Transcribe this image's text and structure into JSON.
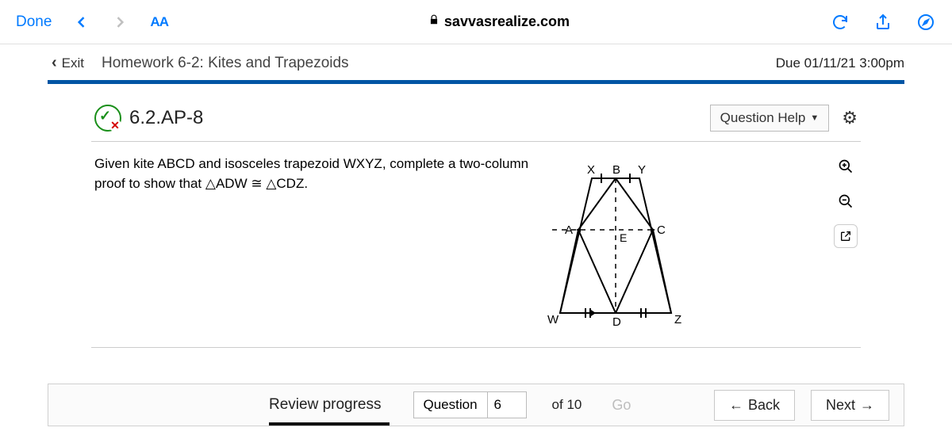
{
  "browser": {
    "done": "Done",
    "text_size": "AA",
    "url": "savvasrealize.com"
  },
  "assignment": {
    "exit": "Exit",
    "title": "Homework 6-2: Kites and Trapezoids",
    "due": "Due 01/11/21 3:00pm"
  },
  "question": {
    "id": "6.2.AP-8",
    "help_label": "Question Help",
    "prompt_line1": "Given kite ABCD and isosceles trapezoid WXYZ, complete a two-column",
    "prompt_line2": "proof to show that ",
    "tri_adw": "ADW",
    "congruent": " ≅ ",
    "tri_cdz": "CDZ."
  },
  "figure": {
    "labels": {
      "X": "X",
      "B": "B",
      "Y": "Y",
      "A": "A",
      "C": "C",
      "E": "E",
      "W": "W",
      "D": "D",
      "Z": "Z"
    }
  },
  "footer": {
    "review": "Review progress",
    "question_label": "Question",
    "current": "6",
    "of": "of 10",
    "go": "Go",
    "back": "Back",
    "next": "Next"
  }
}
